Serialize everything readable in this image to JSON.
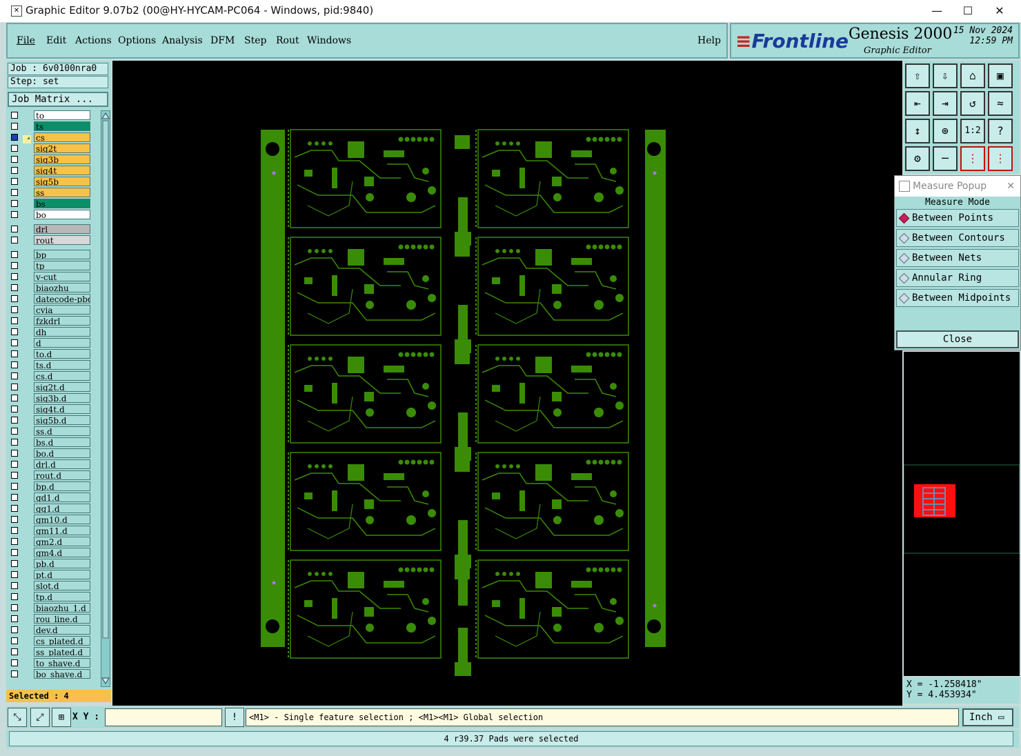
{
  "window": {
    "title": "Graphic Editor 9.07b2 (00@HY-HYCAM-PC064 - Windows, pid:9840)",
    "minimize": "—",
    "maximize": "☐",
    "close": "✕"
  },
  "menu": {
    "items": [
      "File",
      "Edit",
      "Actions",
      "Options",
      "Analysis",
      "DFM",
      "Step",
      "Rout",
      "Windows"
    ],
    "help": "Help"
  },
  "brand": {
    "logo": "Frontline",
    "product": "Genesis 2000",
    "subtitle": "Graphic Editor",
    "date": "15 Nov 2024",
    "time": "12:59 PM"
  },
  "job": {
    "job_label": "Job : 6v0100nra0",
    "step_label": "Step: set",
    "matrix_button": "Job Matrix ..."
  },
  "layers": [
    {
      "name": "to",
      "color": "#ffffff",
      "checked": false
    },
    {
      "name": "ts",
      "color": "#0a9068",
      "checked": false
    },
    {
      "name": "cs",
      "color": "#f8c248",
      "checked": true,
      "work": true
    },
    {
      "name": "sig2t",
      "color": "#f8c248",
      "checked": false
    },
    {
      "name": "sig3b",
      "color": "#f8c248",
      "checked": false
    },
    {
      "name": "sig4t",
      "color": "#f8c248",
      "checked": false
    },
    {
      "name": "sig5b",
      "color": "#f8c248",
      "checked": false
    },
    {
      "name": "ss",
      "color": "#f8c248",
      "checked": false
    },
    {
      "name": "bs",
      "color": "#0a9068",
      "checked": false
    },
    {
      "name": "bo",
      "color": "#ffffff",
      "checked": false
    },
    {
      "name": "drl",
      "color": "#b8b8b8",
      "checked": false,
      "gap": true
    },
    {
      "name": "rout",
      "color": "#d8d8d8",
      "checked": false
    },
    {
      "name": "bp",
      "color": "#a8dcd8",
      "checked": false,
      "gap": true
    },
    {
      "name": "tp",
      "color": "#a8dcd8",
      "checked": false
    },
    {
      "name": "v-cut",
      "color": "#a8dcd8",
      "checked": false
    },
    {
      "name": "biaozhu",
      "color": "#a8dcd8",
      "checked": false
    },
    {
      "name": "datecode-pbd",
      "color": "#a8dcd8",
      "checked": false
    },
    {
      "name": "cvia",
      "color": "#a8dcd8",
      "checked": false
    },
    {
      "name": "fzkdrl",
      "color": "#a8dcd8",
      "checked": false
    },
    {
      "name": "dh",
      "color": "#a8dcd8",
      "checked": false
    },
    {
      "name": "d",
      "color": "#a8dcd8",
      "checked": false
    },
    {
      "name": "to.d",
      "color": "#a8dcd8",
      "checked": false
    },
    {
      "name": "ts.d",
      "color": "#a8dcd8",
      "checked": false
    },
    {
      "name": "cs.d",
      "color": "#a8dcd8",
      "checked": false
    },
    {
      "name": "sig2t.d",
      "color": "#a8dcd8",
      "checked": false
    },
    {
      "name": "sig3b.d",
      "color": "#a8dcd8",
      "checked": false
    },
    {
      "name": "sig4t.d",
      "color": "#a8dcd8",
      "checked": false
    },
    {
      "name": "sig5b.d",
      "color": "#a8dcd8",
      "checked": false
    },
    {
      "name": "ss.d",
      "color": "#a8dcd8",
      "checked": false
    },
    {
      "name": "bs.d",
      "color": "#a8dcd8",
      "checked": false
    },
    {
      "name": "bo.d",
      "color": "#a8dcd8",
      "checked": false
    },
    {
      "name": "drl.d",
      "color": "#a8dcd8",
      "checked": false
    },
    {
      "name": "rout.d",
      "color": "#a8dcd8",
      "checked": false
    },
    {
      "name": "bp.d",
      "color": "#a8dcd8",
      "checked": false
    },
    {
      "name": "gd1.d",
      "color": "#a8dcd8",
      "checked": false
    },
    {
      "name": "gg1.d",
      "color": "#a8dcd8",
      "checked": false
    },
    {
      "name": "gm10.d",
      "color": "#a8dcd8",
      "checked": false
    },
    {
      "name": "gm11.d",
      "color": "#a8dcd8",
      "checked": false
    },
    {
      "name": "gm2.d",
      "color": "#a8dcd8",
      "checked": false
    },
    {
      "name": "gm4.d",
      "color": "#a8dcd8",
      "checked": false
    },
    {
      "name": "pb.d",
      "color": "#a8dcd8",
      "checked": false
    },
    {
      "name": "pt.d",
      "color": "#a8dcd8",
      "checked": false
    },
    {
      "name": "slot.d",
      "color": "#a8dcd8",
      "checked": false
    },
    {
      "name": "tp.d",
      "color": "#a8dcd8",
      "checked": false
    },
    {
      "name": "biaozhu_1.d",
      "color": "#a8dcd8",
      "checked": false
    },
    {
      "name": "rou_line.d",
      "color": "#a8dcd8",
      "checked": false
    },
    {
      "name": "dev.d",
      "color": "#a8dcd8",
      "checked": false
    },
    {
      "name": "cs_plated.d",
      "color": "#a8dcd8",
      "checked": false
    },
    {
      "name": "ss_plated.d",
      "color": "#a8dcd8",
      "checked": false
    },
    {
      "name": "to_shave.d",
      "color": "#a8dcd8",
      "checked": false
    },
    {
      "name": "bo_shave.d",
      "color": "#a8dcd8",
      "checked": false
    }
  ],
  "selected_label": "Selected : 4",
  "tools": {
    "icons": [
      "export-icon",
      "import-icon",
      "home-icon",
      "window-icon",
      "step-left-icon",
      "step-right-icon",
      "rotate-icon",
      "snake-icon",
      "fit-vertical-icon",
      "fit-all-icon",
      "scale-icon",
      "help-icon",
      "tools-icon",
      "probe-icon",
      "netlist-icon",
      "netlist-alt-icon"
    ],
    "glyphs": [
      "⇧",
      "⇩",
      "⌂",
      "▣",
      "⇤",
      "⇥",
      "↺",
      "≈",
      "↕",
      "⊕",
      "",
      "?",
      "⚙",
      "─",
      "⋮",
      "⋮"
    ],
    "scale_label": "1:2"
  },
  "measure": {
    "title": "Measure Popup",
    "mode_label": "Measure Mode",
    "options": [
      "Between Points",
      "Between Contours",
      "Between Nets",
      "Annular Ring",
      "Between Midpoints"
    ],
    "selected": "Between Points",
    "close": "Close"
  },
  "coords": {
    "x": "X = -1.258418\"",
    "y": "Y = 4.453934\""
  },
  "bottom": {
    "xy_label": "X Y :",
    "xy_value": "",
    "warn_icon": "!",
    "hint": "<M1> - Single feature selection ; <M1><M1> Global selection",
    "units": "Inch"
  },
  "status": "4 r39.37 Pads were selected",
  "colors": {
    "panel": "#a8dcd8",
    "copper": "#3a8c06",
    "canvas": "#000000",
    "selected": "#f6c04a"
  }
}
